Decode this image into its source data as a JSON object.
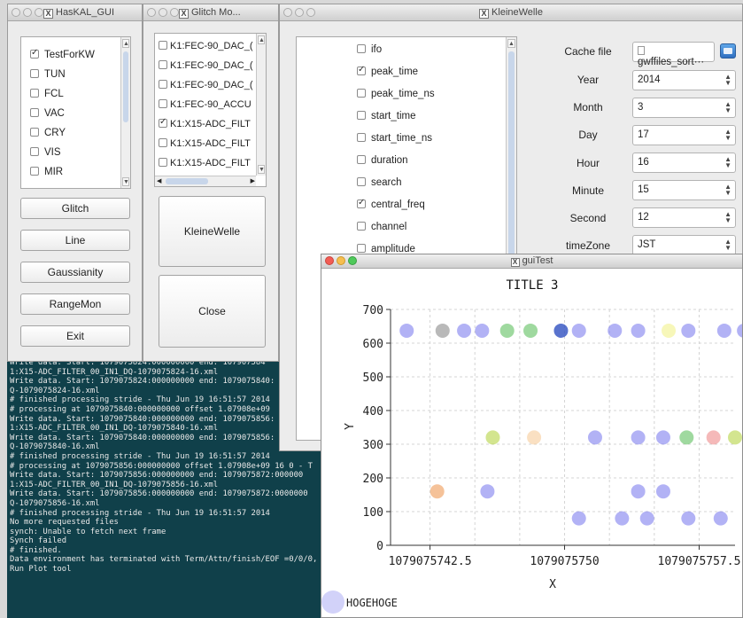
{
  "haskal": {
    "title": "HasKAL_GUI",
    "checks": [
      {
        "label": "TestForKW",
        "checked": true
      },
      {
        "label": "TUN",
        "checked": false
      },
      {
        "label": "FCL",
        "checked": false
      },
      {
        "label": "VAC",
        "checked": false
      },
      {
        "label": "CRY",
        "checked": false
      },
      {
        "label": "VIS",
        "checked": false
      },
      {
        "label": "MIR",
        "checked": false
      }
    ],
    "buttons": [
      "Glitch",
      "Line",
      "Gaussianity",
      "RangeMon",
      "Exit"
    ]
  },
  "glitch": {
    "title": "Glitch Mo...",
    "items": [
      {
        "label": "K1:FEC-90_DAC_(",
        "checked": false
      },
      {
        "label": "K1:FEC-90_DAC_(",
        "checked": false
      },
      {
        "label": "K1:FEC-90_DAC_(",
        "checked": false
      },
      {
        "label": "K1:FEC-90_ACCU",
        "checked": false
      },
      {
        "label": "K1:X15-ADC_FILT",
        "checked": true
      },
      {
        "label": "K1:X15-ADC_FILT",
        "checked": false
      },
      {
        "label": "K1:X15-ADC_FILT",
        "checked": false
      }
    ],
    "kw_button": "KleineWelle",
    "close_button": "Close"
  },
  "kleinewelle": {
    "title": "KleineWelle",
    "params": [
      {
        "label": "ifo",
        "checked": false
      },
      {
        "label": "peak_time",
        "checked": true
      },
      {
        "label": "peak_time_ns",
        "checked": false
      },
      {
        "label": "start_time",
        "checked": false
      },
      {
        "label": "start_time_ns",
        "checked": false
      },
      {
        "label": "duration",
        "checked": false
      },
      {
        "label": "search",
        "checked": false
      },
      {
        "label": "central_freq",
        "checked": true
      },
      {
        "label": "channel",
        "checked": false
      },
      {
        "label": "amplitude",
        "checked": false
      }
    ],
    "cache_label": "Cache file",
    "cache_value": "gwffiles_sort···",
    "fields": [
      {
        "label": "Year",
        "value": "2014"
      },
      {
        "label": "Month",
        "value": "3"
      },
      {
        "label": "Day",
        "value": "17"
      },
      {
        "label": "Hour",
        "value": "16"
      },
      {
        "label": "Minute",
        "value": "15"
      },
      {
        "label": "Second",
        "value": "12"
      },
      {
        "label": "timeZone",
        "value": "JST"
      }
    ]
  },
  "terminal": {
    "lines": [
      "Write data. Start: 1079075824:000000000 end: 107907584",
      "1:X15-ADC_FILTER_00_IN1_DQ-1079075824-16.xml",
      "Write data. Start: 1079075824:000000000 end: 1079075840:",
      "Q-1079075824-16.xml",
      "# finished processing stride - Thu Jun 19 16:51:57 2014",
      "# processing at 1079075840:000000000 offset 1.07908e+09",
      "Write data. Start: 1079075840:000000000 end: 1079075856:",
      "1:X15-ADC_FILTER_00_IN1_DQ-1079075840-16.xml",
      "Write data. Start: 1079075840:000000000 end: 1079075856:",
      "Q-1079075840-16.xml",
      "# finished processing stride - Thu Jun 19 16:51:57 2014",
      "# processing at 1079075856:000000000 offset 1.07908e+09 16 0 - T",
      "Write data. Start: 1079075856:000000000 end: 1079075872:000000",
      "1:X15-ADC_FILTER_00_IN1_DQ-1079075856-16.xml",
      "Write data. Start: 1079075856:000000000 end: 1079075872:0000000",
      "Q-1079075856-16.xml",
      "# finished processing stride - Thu Jun 19 16:51:57 2014",
      "No more requested files",
      "synch: Unable to fetch next frame",
      "Synch failed",
      "# finished.",
      "Data environment has terminated with Term/Attn/finish/EOF =0/0/0,",
      "Run Plot tool"
    ]
  },
  "guitest": {
    "title": "guiTest",
    "colors": {
      "blue": "#7f7fef",
      "gray": "#8a8a8a",
      "green": "#5fbf5f",
      "navy": "#3050c0",
      "yellow": "#f2f28a",
      "olive": "#b5d445",
      "peach": "#f7cc9a",
      "red": "#ef8a8a",
      "orange": "#ef9a55"
    }
  },
  "chart_data": {
    "type": "scatter",
    "title": "TITLE 3",
    "xlabel": "X",
    "ylabel": "Y",
    "xlim": [
      1079075740.3,
      1079075759.5
    ],
    "ylim": [
      0,
      700
    ],
    "grid": true,
    "xticks": [
      "1079075742.5",
      "1079075750",
      "1079075757.5"
    ],
    "yticks": [
      "0",
      "100",
      "200",
      "300",
      "400",
      "500",
      "600",
      "700"
    ],
    "legend": {
      "position": "bottom-left",
      "entries": [
        "HOGEHOGE"
      ]
    },
    "points": [
      {
        "x": 1079075741.2,
        "y": 637,
        "c": "blue"
      },
      {
        "x": 1079075743.2,
        "y": 637,
        "c": "gray"
      },
      {
        "x": 1079075744.4,
        "y": 637,
        "c": "blue"
      },
      {
        "x": 1079075745.4,
        "y": 637,
        "c": "blue"
      },
      {
        "x": 1079075746.8,
        "y": 637,
        "c": "green"
      },
      {
        "x": 1079075748.1,
        "y": 637,
        "c": "green"
      },
      {
        "x": 1079075749.8,
        "y": 637,
        "c": "navy"
      },
      {
        "x": 1079075750.8,
        "y": 637,
        "c": "blue"
      },
      {
        "x": 1079075752.8,
        "y": 637,
        "c": "blue"
      },
      {
        "x": 1079075754.1,
        "y": 637,
        "c": "blue"
      },
      {
        "x": 1079075755.8,
        "y": 637,
        "c": "yellow"
      },
      {
        "x": 1079075756.9,
        "y": 637,
        "c": "blue"
      },
      {
        "x": 1079075758.9,
        "y": 637,
        "c": "blue"
      },
      {
        "x": 1079075760.0,
        "y": 637,
        "c": "blue"
      },
      {
        "x": 1079075746.0,
        "y": 320,
        "c": "olive"
      },
      {
        "x": 1079075748.3,
        "y": 320,
        "c": "peach"
      },
      {
        "x": 1079075751.7,
        "y": 320,
        "c": "blue"
      },
      {
        "x": 1079075754.1,
        "y": 320,
        "c": "blue"
      },
      {
        "x": 1079075755.5,
        "y": 320,
        "c": "blue"
      },
      {
        "x": 1079075756.8,
        "y": 320,
        "c": "green"
      },
      {
        "x": 1079075758.3,
        "y": 320,
        "c": "red"
      },
      {
        "x": 1079075759.5,
        "y": 320,
        "c": "olive"
      },
      {
        "x": 1079075742.9,
        "y": 160,
        "c": "orange"
      },
      {
        "x": 1079075745.7,
        "y": 160,
        "c": "blue"
      },
      {
        "x": 1079075754.1,
        "y": 160,
        "c": "blue"
      },
      {
        "x": 1079075755.5,
        "y": 160,
        "c": "blue"
      },
      {
        "x": 1079075750.8,
        "y": 80,
        "c": "blue"
      },
      {
        "x": 1079075753.2,
        "y": 80,
        "c": "blue"
      },
      {
        "x": 1079075754.6,
        "y": 80,
        "c": "blue"
      },
      {
        "x": 1079075756.9,
        "y": 80,
        "c": "blue"
      },
      {
        "x": 1079075758.7,
        "y": 80,
        "c": "blue"
      }
    ]
  }
}
